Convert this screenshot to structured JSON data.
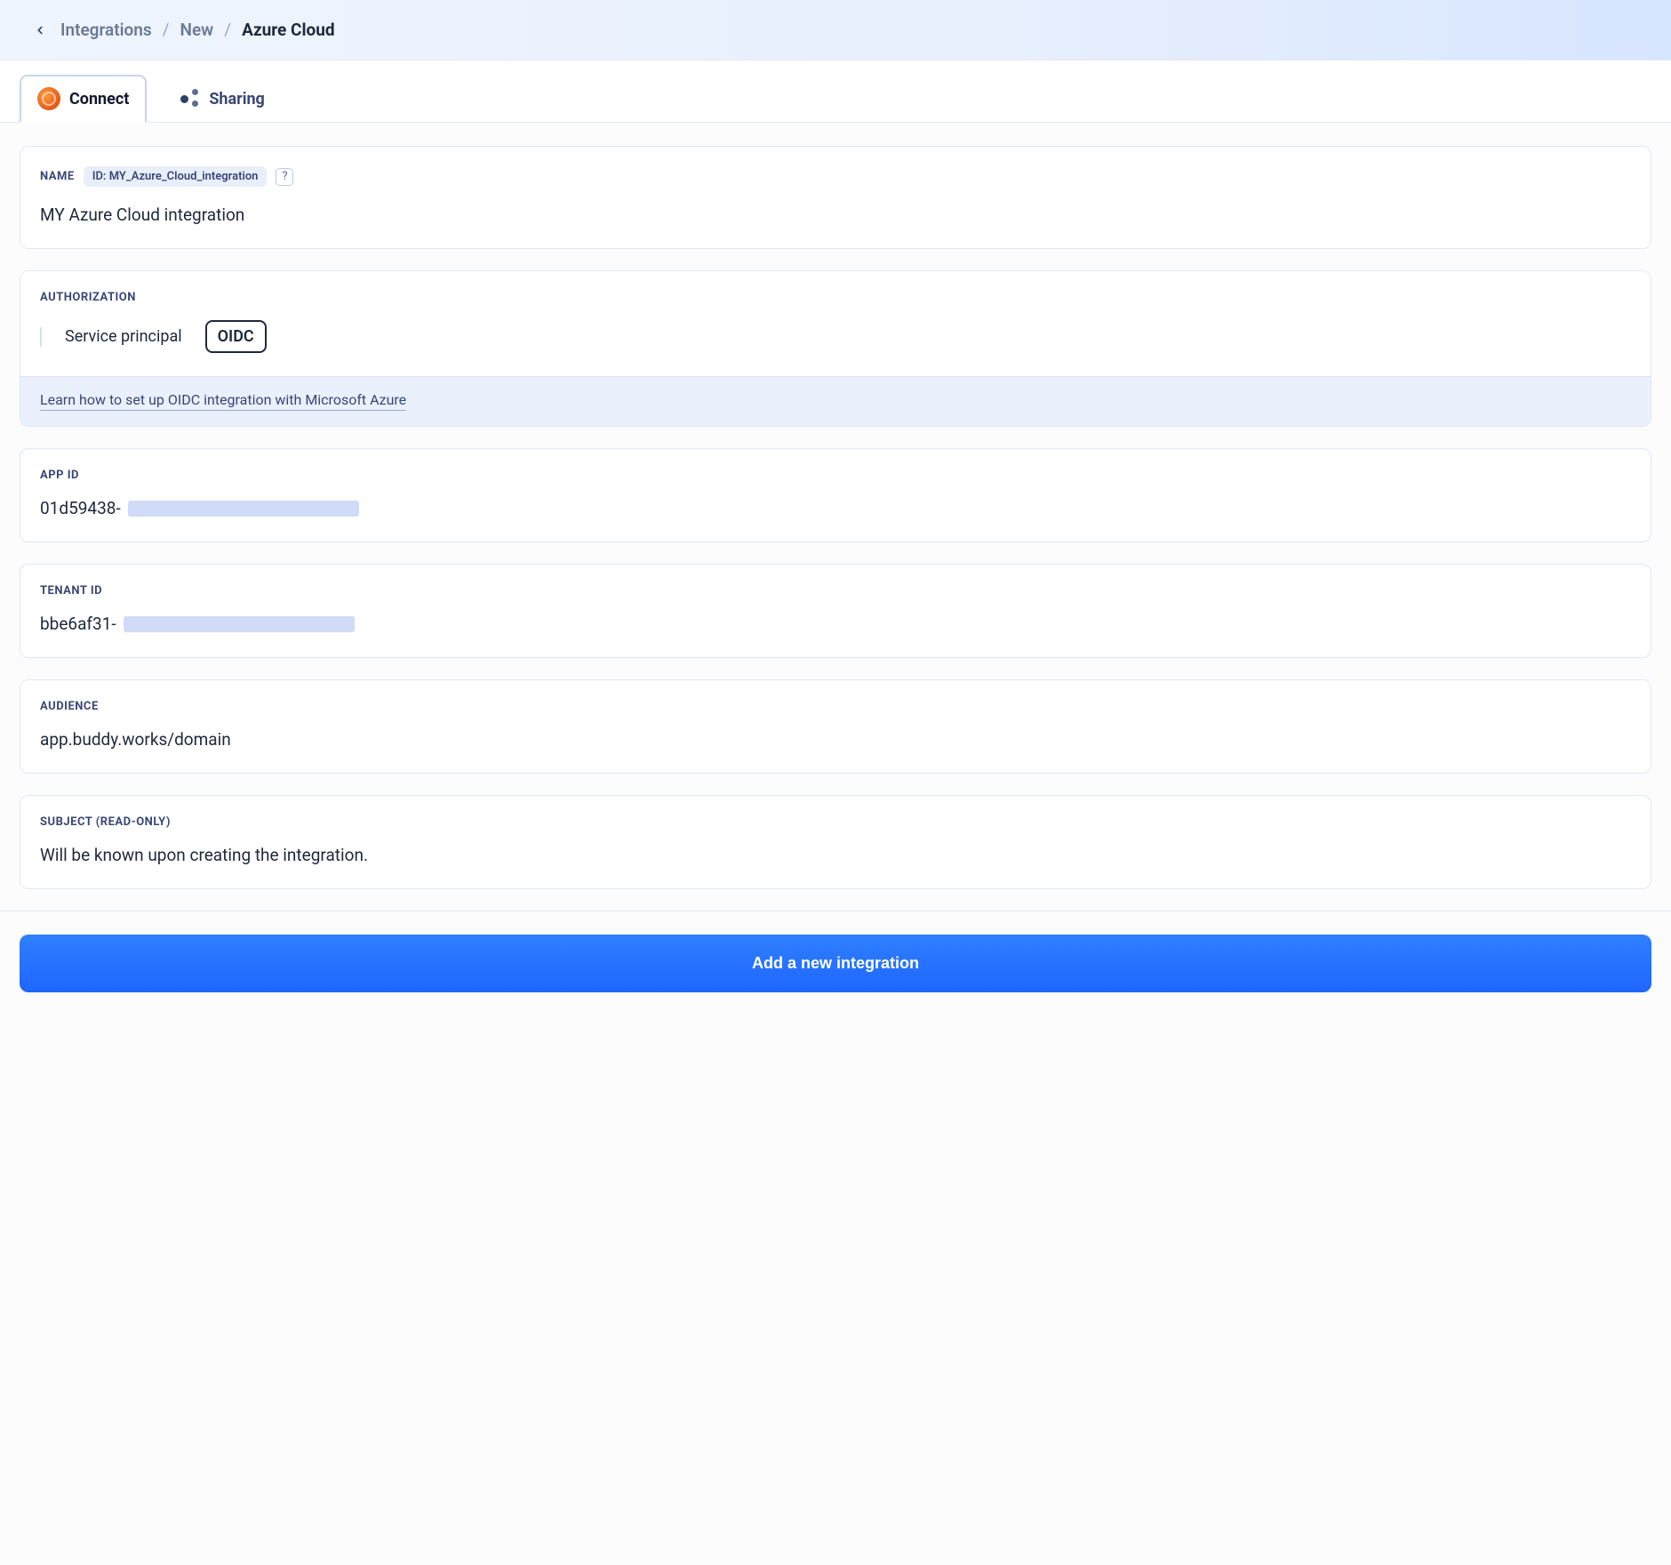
{
  "breadcrumb": {
    "items": [
      "Integrations",
      "New"
    ],
    "current": "Azure Cloud"
  },
  "tabs": {
    "connect": "Connect",
    "sharing": "Sharing"
  },
  "name_card": {
    "label": "NAME",
    "id_prefix": "ID:",
    "id_value": "MY_Azure_Cloud_integration",
    "help_symbol": "?",
    "value": "MY Azure Cloud integration"
  },
  "auth_card": {
    "label": "AUTHORIZATION",
    "opt_service_principal": "Service principal",
    "opt_oidc": "OIDC",
    "info_link": "Learn how to set up OIDC integration with Microsoft Azure"
  },
  "app_id_card": {
    "label": "APP ID",
    "value_prefix": "01d59438-"
  },
  "tenant_id_card": {
    "label": "TENANT ID",
    "value_prefix": "bbe6af31-"
  },
  "audience_card": {
    "label": "AUDIENCE",
    "value": "app.buddy.works/domain"
  },
  "subject_card": {
    "label": "SUBJECT (READ-ONLY)",
    "value": "Will be known upon creating the integration."
  },
  "footer": {
    "button": "Add a new integration"
  }
}
